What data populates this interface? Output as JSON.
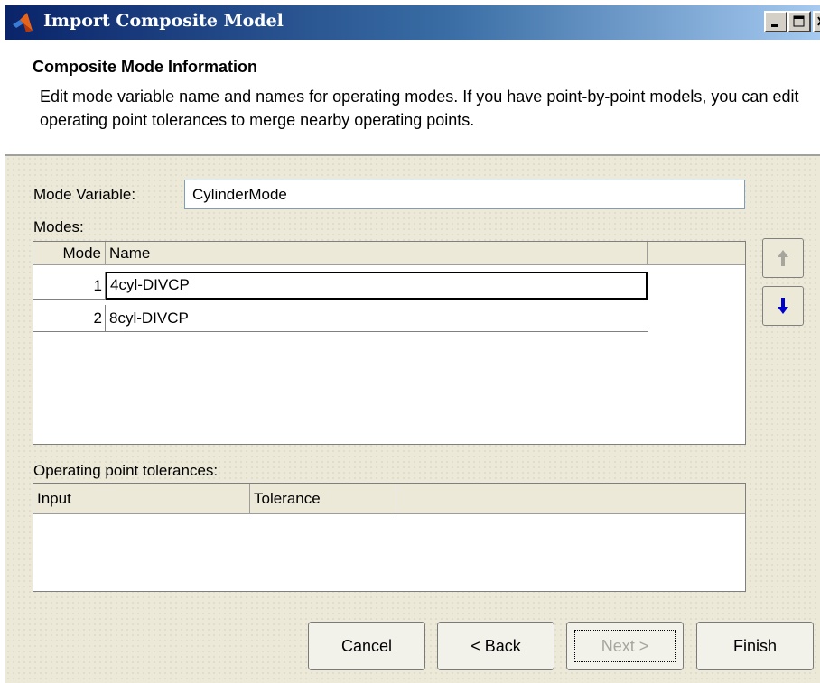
{
  "window": {
    "title": "Import Composite Model",
    "controls": [
      "minimize-icon",
      "maximize-icon",
      "close-icon"
    ]
  },
  "header": {
    "title": "Composite Mode Information",
    "description": "Edit mode variable name and names for operating modes. If you have point-by-point models, you can edit operating point tolerances to merge nearby operating points."
  },
  "mode_variable": {
    "label": "Mode Variable:",
    "value": "CylinderMode"
  },
  "modes": {
    "label": "Modes:",
    "columns": [
      "Mode",
      "Name"
    ],
    "rows": [
      {
        "mode": "1",
        "name": "4cyl-DIVCP"
      },
      {
        "mode": "2",
        "name": "8cyl-DIVCP"
      }
    ],
    "move_up_icon": "arrow-up-icon",
    "move_down_icon": "arrow-down-icon"
  },
  "tolerances": {
    "label": "Operating point tolerances:",
    "columns": [
      "Input",
      "Tolerance"
    ],
    "rows": []
  },
  "buttons": {
    "cancel": "Cancel",
    "back": "< Back",
    "next": "Next >",
    "finish": "Finish"
  },
  "colors": {
    "titlebar_start": "#0a246a",
    "titlebar_end": "#a6caf0",
    "dialog_bg": "#ece9d8",
    "down_arrow": "#0000cc",
    "up_arrow_disabled": "#a7a69e"
  }
}
